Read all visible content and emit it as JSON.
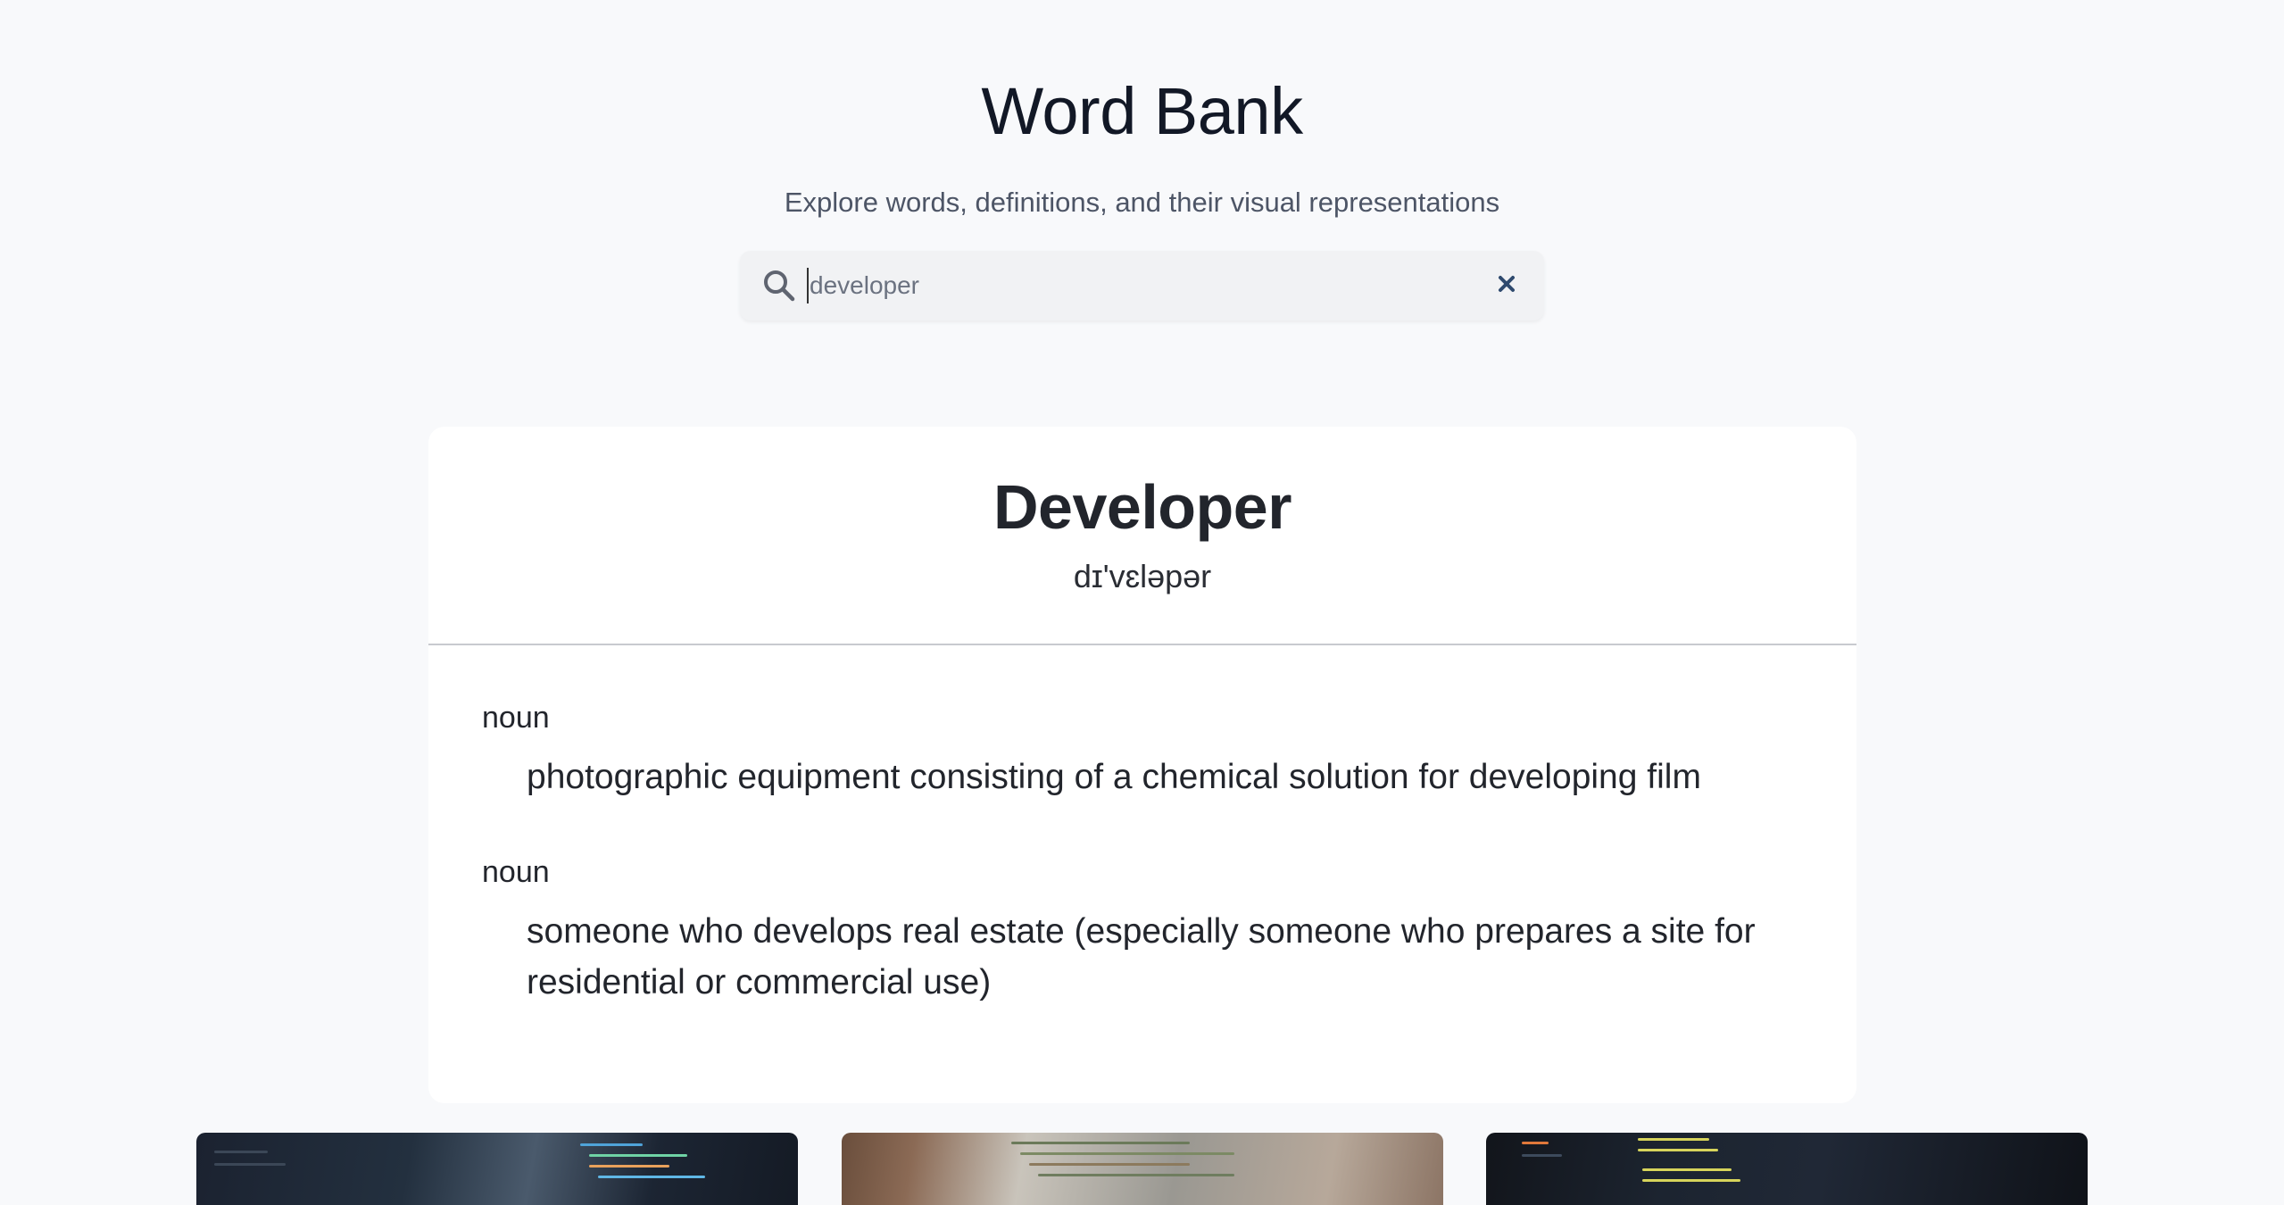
{
  "header": {
    "title": "Word Bank",
    "subtitle": "Explore words, definitions, and their visual representations"
  },
  "search": {
    "placeholder": "developer",
    "value": "",
    "icon": "search-icon",
    "clear_icon": "close-icon"
  },
  "entry": {
    "word": "Developer",
    "phonetic": "dɪ'vɛləpər",
    "meanings": [
      {
        "part_of_speech": "noun",
        "definition": "photographic equipment consisting of a chemical solution for developing film"
      },
      {
        "part_of_speech": "noun",
        "definition": "someone who develops real estate (especially someone who prepares a site for residential or commercial use)"
      }
    ]
  },
  "images": [
    {
      "name": "image-thumbnail-1"
    },
    {
      "name": "image-thumbnail-2"
    },
    {
      "name": "image-thumbnail-3"
    }
  ],
  "colors": {
    "background": "#f8f9fb",
    "card": "#ffffff",
    "clear_icon": "#2f4a6e"
  }
}
